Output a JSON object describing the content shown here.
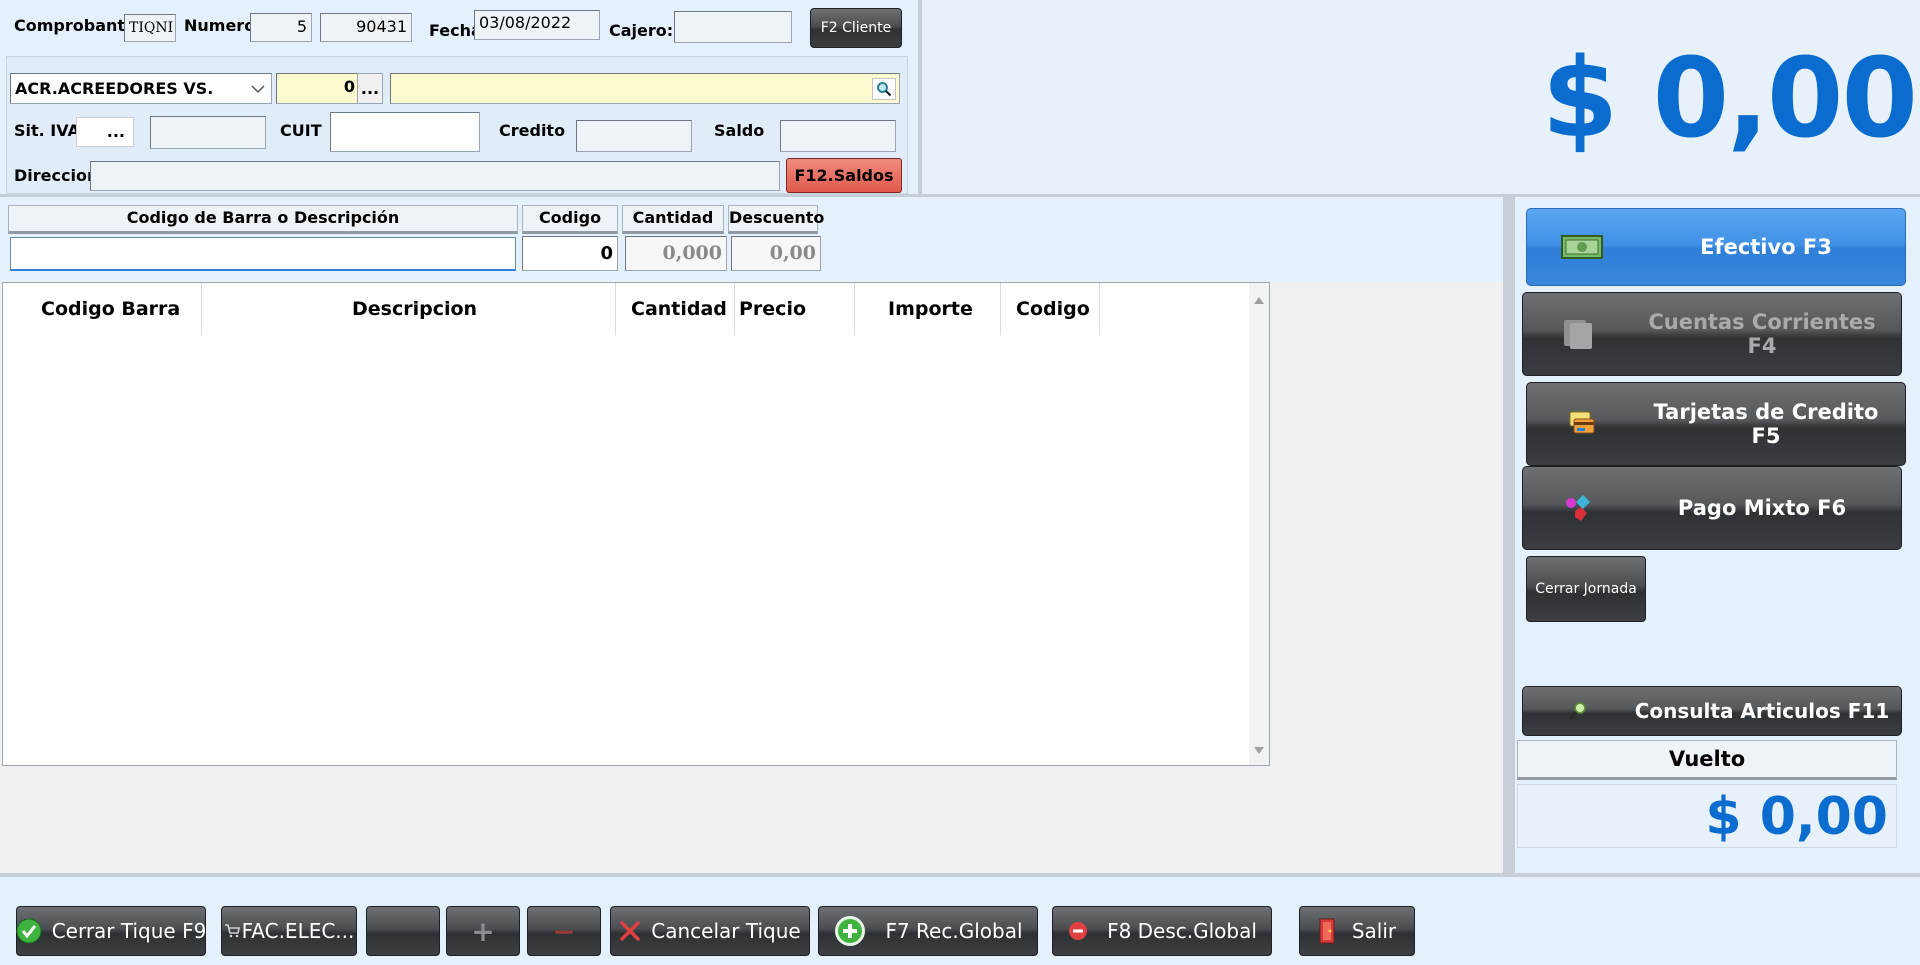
{
  "header": {
    "comprobante_label": "Comprobante",
    "comprobante_value": "TIQNI",
    "numero_label": "Numero",
    "numero_pv": "5",
    "numero_nro": "90431",
    "fecha_label": "Fecha",
    "fecha_value": "03/08/2022",
    "cajero_label": "Cajero:",
    "cajero_value": "",
    "f2_cliente_label": "F2 Cliente"
  },
  "client": {
    "account_selected": "ACR.ACREEDORES VS.",
    "code_value": "0",
    "code_browse_label": "...",
    "name_value": "",
    "sit_iva_label": "Sit. IVA",
    "sit_iva_browse_label": "...",
    "sit_iva_value": "",
    "cuit_label": "CUIT",
    "cuit_value": "",
    "credito_label": "Credito",
    "credito_value": "",
    "saldo_label": "Saldo",
    "saldo_value": "",
    "direccion_label": "Direccion",
    "direccion_value": "",
    "f12_saldos_label": "F12.Saldos"
  },
  "total": {
    "amount": "$ 0,00",
    "color": "#0a6ccf"
  },
  "entry": {
    "barcode_header": "Codigo de Barra o Descripción",
    "codigo_header": "Codigo",
    "cantidad_header": "Cantidad",
    "descuento_header": "Descuento",
    "barcode_value": "",
    "codigo_value": "0",
    "cantidad_value": "0,000",
    "descuento_value": "0,00"
  },
  "grid": {
    "columns": [
      "Codigo Barra",
      "Descripcion",
      "Cantidad",
      "Precio",
      "Importe",
      "Codigo"
    ],
    "rows": []
  },
  "payments": {
    "efectivo_label": "Efectivo F3",
    "cuentas_label": "Cuentas Corrientes F4",
    "tarjetas_label": "Tarjetas de Credito F5",
    "mixto_label": "Pago Mixto F6",
    "cerrar_jornada_label": "Cerrar Jornada",
    "consulta_label": "Consulta Articulos F11",
    "vuelto_label": "Vuelto",
    "vuelto_amount": "$ 0,00"
  },
  "toolbar": {
    "cerrar_tique_label": "Cerrar Tique F9",
    "fac_elec_label": "FAC.ELEC...",
    "blank_label": "",
    "plus_label": "+",
    "minus_label": "−",
    "cancelar_label": "Cancelar Tique",
    "rec_global_label": "F7 Rec.Global",
    "desc_global_label": "F8 Desc.Global",
    "salir_label": "Salir"
  },
  "icons": {
    "cerrar_tique": "check-circle-icon",
    "fac_elec": "cart-icon",
    "cancelar": "x-icon",
    "rec_global": "plus-circle-icon",
    "desc_global": "minus-circle-icon",
    "salir": "door-exit-icon",
    "efectivo": "banknote-icon",
    "cuentas": "documents-icon",
    "tarjetas": "credit-card-icon",
    "mixto": "mixed-shapes-icon",
    "consulta": "magnifier-icon"
  }
}
